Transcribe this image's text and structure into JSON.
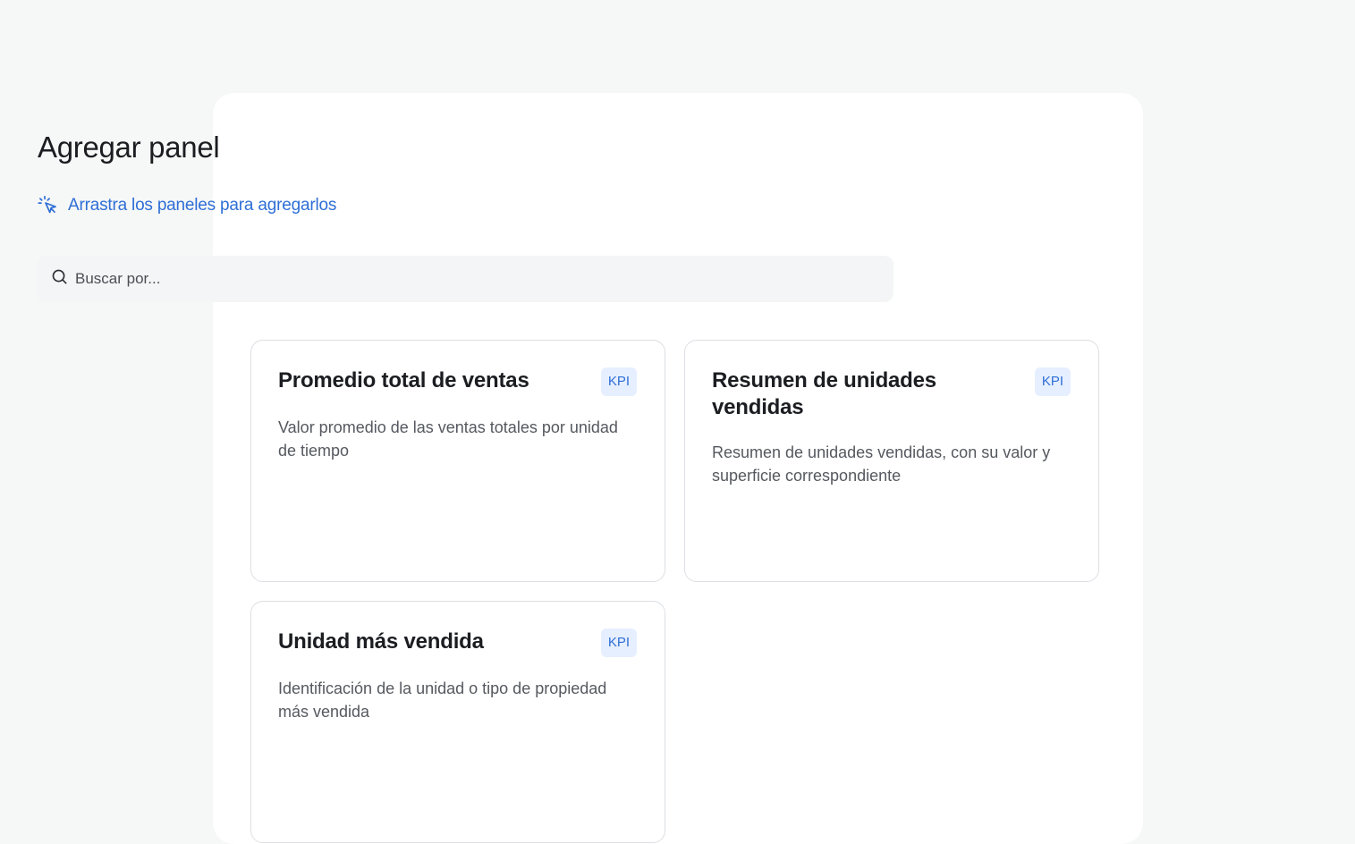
{
  "dialog": {
    "title": "Agregar panel",
    "hint": "Arrastra los paneles para agregarlos"
  },
  "search": {
    "placeholder": "Buscar por..."
  },
  "panels": [
    {
      "title": "Promedio total de ventas",
      "badge": "KPI",
      "description": "Valor promedio de las ventas totales por unidad de tiempo"
    },
    {
      "title": "Resumen de unidades vendidas",
      "badge": "KPI",
      "description": "Resumen de unidades vendidas, con su valor y superficie correspondiente"
    },
    {
      "title": "Unidad más vendida",
      "badge": "KPI",
      "description": "Identificación de la unidad o tipo de propiedad más vendida"
    }
  ],
  "colors": {
    "accent": "#2f6fd6",
    "badge_bg": "#e6efff",
    "page_bg": "#f6f7f7"
  }
}
